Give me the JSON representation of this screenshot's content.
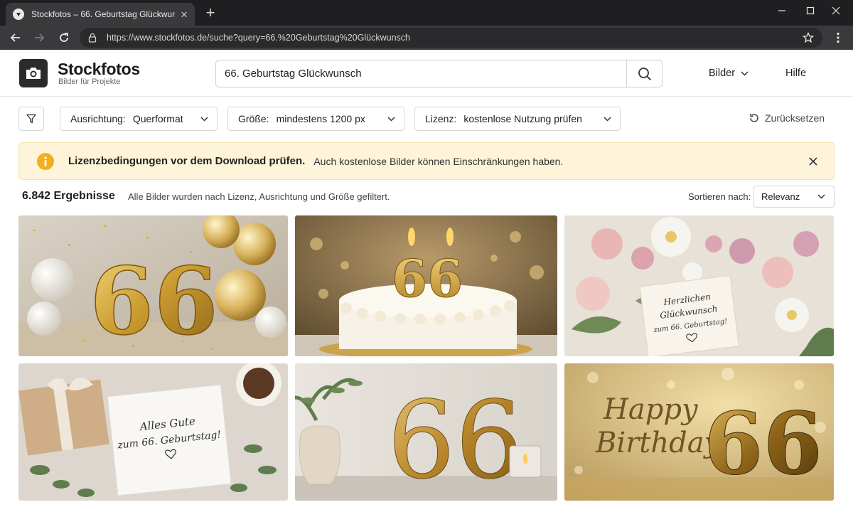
{
  "browser": {
    "tab_title": "Stockfotos – 66. Geburtstag Glückwunsch",
    "url": "https://www.stockfotos.de/suche?query=66.%20Geburtstag%20Glückwunsch"
  },
  "site": {
    "brand": "Stockfotos",
    "tagline": "Bilder für Projekte",
    "search_value": "66. Geburtstag Glückwunsch",
    "nav": {
      "images": "Bilder",
      "help": "Hilfe"
    }
  },
  "filters": {
    "orientation": {
      "label": "Ausrichtung:",
      "value": "Querformat"
    },
    "size": {
      "label": "Größe:",
      "value": "mindestens 1200 px"
    },
    "license": {
      "label": "Lizenz:",
      "value": "kostenlose Nutzung prüfen"
    },
    "reset": "Zurücksetzen"
  },
  "banner": {
    "title": "Lizenzbedingungen vor dem Download prüfen.",
    "text": "Auch kostenlose Bilder können Einschränkungen haben."
  },
  "results": {
    "count": "6.842 Ergebnisse",
    "note": "Alle Bilder wurden nach Lizenz, Ausrichtung und Größe gefiltert.",
    "sort_label": "Sortieren nach:",
    "sort_value": "Relevanz"
  },
  "images": [
    {
      "number": "66"
    },
    {
      "number": "66"
    },
    {
      "card_line1": "Herzlichen",
      "card_line2": "Glückwunsch",
      "card_line3": "zum 66. Geburtstag!"
    },
    {
      "card_line1": "Alles Gute",
      "card_line2": "zum 66. Geburtstag!"
    },
    {
      "number": "66"
    },
    {
      "line1": "Happy",
      "line2": "Birthday",
      "number": "66"
    }
  ],
  "colors": {
    "gold": "#c99a2e",
    "banner_bg": "#fdf4d9",
    "warning": "#f2b01e",
    "chrome_dark": "#1f1f21"
  }
}
